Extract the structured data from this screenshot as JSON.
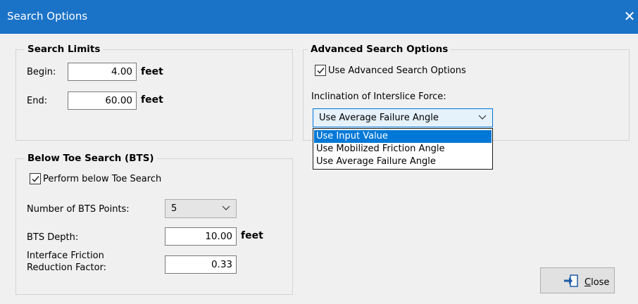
{
  "window": {
    "title": "Search Options",
    "close_glyph": "✕"
  },
  "search_limits": {
    "title": "Search Limits",
    "begin_label": "Begin:",
    "begin_value": "4.00",
    "begin_unit": "feet",
    "end_label": "End:",
    "end_value": "60.00",
    "end_unit": "feet"
  },
  "advanced": {
    "title": "Advanced Search Options",
    "use_advanced_label": "Use Advanced Search Options",
    "use_advanced_checked": true,
    "inclination_label": "Inclination of Interslice Force:",
    "inclination_selected": "Use Average Failure Angle",
    "inclination_options": [
      "Use Input Value",
      "Use Mobilized Friction Angle",
      "Use Average Failure Angle"
    ],
    "highlighted_option_index": 0
  },
  "bts": {
    "title": "Below Toe Search (BTS)",
    "perform_label": "Perform below Toe Search",
    "perform_checked": true,
    "points_label": "Number of BTS Points:",
    "points_value": "5",
    "depth_label": "BTS Depth:",
    "depth_value": "10.00",
    "depth_unit": "feet",
    "friction_label_line1": "Interface Friction",
    "friction_label_line2": "Reduction Factor:",
    "friction_value": "0.33"
  },
  "buttons": {
    "close_mnemonic": "C",
    "close_rest": "lose",
    "close_icon": "exit-door-arrow-icon"
  },
  "colors": {
    "titlebar": "#1b73c7",
    "selection": "#0078d7",
    "dialog_bg": "#f0f0f0"
  }
}
